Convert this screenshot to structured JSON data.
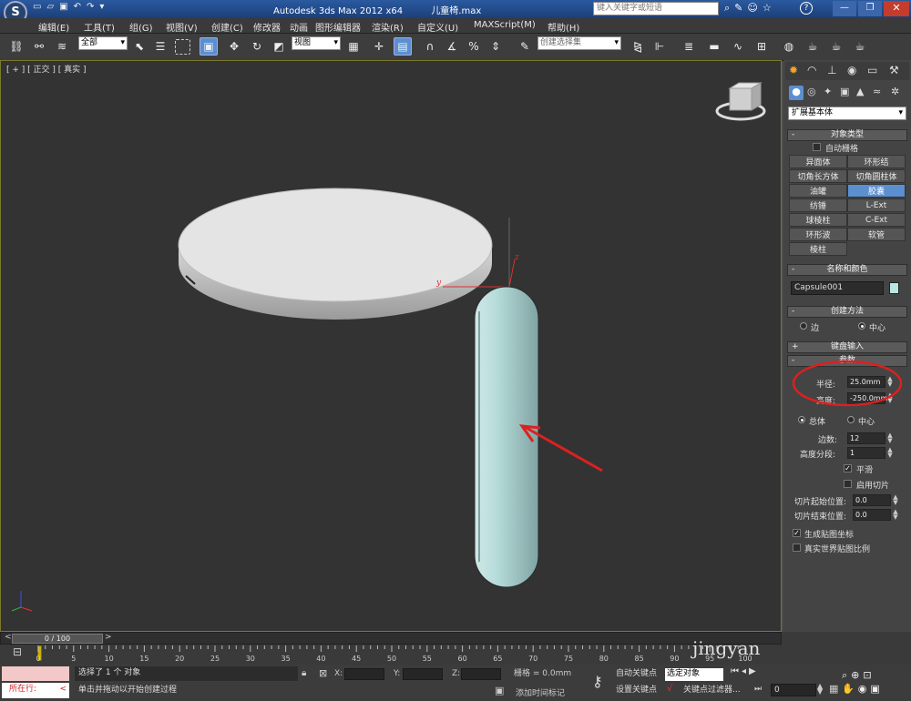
{
  "app": {
    "title": "Autodesk 3ds Max  2012 x64",
    "filename": "儿童椅.max",
    "search_placeholder": "键入关键字或短语"
  },
  "menu": [
    "编辑(E)",
    "工具(T)",
    "组(G)",
    "视图(V)",
    "创建(C)",
    "修改器",
    "动画",
    "图形编辑器",
    "渲染(R)",
    "自定义(U)",
    "MAXScript(M)",
    "帮助(H)"
  ],
  "toolbar": {
    "selection_filter": "全部",
    "ref_coord": "视图",
    "named_selection": "创建选择集"
  },
  "viewport": {
    "label": "[ + ] [ 正交 ] [ 真实 ]",
    "gizmo_x": "x",
    "gizmo_y": "y",
    "gizmo_z": "z"
  },
  "command_panel": {
    "category": "扩展基本体",
    "object_type": {
      "header": "对象类型",
      "autogrid": "自动栅格",
      "buttons": [
        "异面体",
        "环形结",
        "切角长方体",
        "切角圆柱体",
        "油罐",
        "胶囊",
        "纺锤",
        "L-Ext",
        "球棱柱",
        "C-Ext",
        "环形波",
        "软管",
        "棱柱"
      ],
      "active": "胶囊"
    },
    "name_color": {
      "header": "名称和颜色",
      "name": "Capsule001",
      "color": "#b9e6e4"
    },
    "creation_method": {
      "header": "创建方法",
      "edge": "边",
      "center": "中心"
    },
    "keyboard_entry": {
      "header": "键盘输入"
    },
    "parameters": {
      "header": "参数",
      "radius_label": "半径:",
      "radius": "25.0mm",
      "height_label": "高度:",
      "height": "-250.0mm",
      "overall": "总体",
      "centers": "中心",
      "sides_label": "边数:",
      "sides": "12",
      "height_segs_label": "高度分段:",
      "height_segs": "1",
      "smooth": "平滑",
      "slice_on": "启用切片",
      "slice_from_label": "切片起始位置:",
      "slice_from": "0.0",
      "slice_to_label": "切片结束位置:",
      "slice_to": "0.0",
      "gen_map": "生成贴图坐标",
      "real_world": "真实世界贴图比例"
    }
  },
  "timeline": {
    "frame_display": "0 / 100",
    "ticks": [
      "0",
      "5",
      "10",
      "15",
      "20",
      "25",
      "30",
      "35",
      "40",
      "45",
      "50",
      "55",
      "60",
      "65",
      "70",
      "75",
      "80",
      "85",
      "90",
      "95",
      "100"
    ]
  },
  "status": {
    "location": "所在行:",
    "selection_msg": "选择了 1 个 对象",
    "prompt": "单击并拖动以开始创建过程",
    "x_label": "X:",
    "y_label": "Y:",
    "z_label": "Z:",
    "grid": "栅格 = 0.0mm",
    "add_time_tag": "添加时间标记",
    "auto_key": "自动关键点",
    "selected_obj": "选定对象",
    "set_key": "设置关键点",
    "key_filters": "关键点过滤器...",
    "frame": "0"
  },
  "watermark": "jingyan"
}
